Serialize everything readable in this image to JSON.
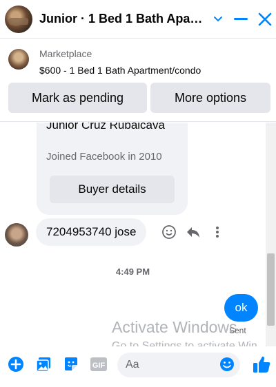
{
  "header": {
    "title": "Junior · 1 Bed 1 Bath Apart...",
    "icons": [
      "chevron-down-icon",
      "minimize-icon",
      "close-icon"
    ]
  },
  "marketplace": {
    "label": "Marketplace",
    "listing": "$600 - 1 Bed 1 Bath Apartment/condo",
    "buttons": {
      "pending": "Mark as pending",
      "more": "More options"
    }
  },
  "chat": {
    "buyer_card": {
      "name": "Junior Cruz Rubalcava",
      "joined": "Joined Facebook in 2010",
      "button": "Buyer details"
    },
    "incoming": {
      "text": "7204953740 jose"
    },
    "timestamp": "4:49 PM",
    "outgoing": {
      "text": "ok",
      "status": "Sent"
    },
    "watermark": {
      "line1": "Activate Windows",
      "line2": "Go to Settings to activate Win"
    }
  },
  "composer": {
    "placeholder": "Aa",
    "icons": [
      "add-icon",
      "photo-icon",
      "sticker-icon",
      "gif-icon",
      "emoji-icon",
      "thumbs-up-icon"
    ],
    "gif_label": "GIF"
  },
  "colors": {
    "accent": "#0084ff",
    "bubble_gray": "#f0f2f5",
    "button_gray": "#e4e6eb"
  }
}
